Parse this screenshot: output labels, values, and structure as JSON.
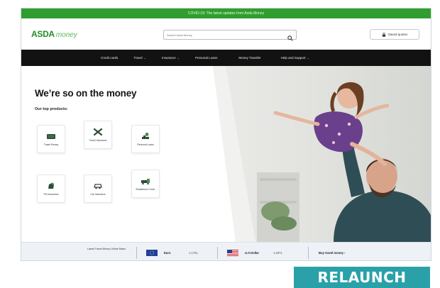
{
  "promo": {
    "text": "COVID-19: The latest updates from Asda Money"
  },
  "header": {
    "logo_brand": "ASDA",
    "logo_product": "money",
    "search_placeholder": "Search Asda Money",
    "save_button_label": "Saved quotes"
  },
  "nav": {
    "items": [
      {
        "label": "Credit cards",
        "has_chevron": false
      },
      {
        "label": "Travel",
        "has_chevron": true
      },
      {
        "label": "Insurance",
        "has_chevron": true
      },
      {
        "label": "Personal Loans",
        "has_chevron": false
      },
      {
        "label": "Money Transfer",
        "has_chevron": false
      },
      {
        "label": "Help and Support",
        "has_chevron": true
      }
    ]
  },
  "hero": {
    "title": "We’re so on the money",
    "subtitle": "Our top products:"
  },
  "products": [
    {
      "label": "Travel Money",
      "icon": "travel-money-icon"
    },
    {
      "label": "Travel Insurance",
      "icon": "plane-icon"
    },
    {
      "label": "Personal Loans",
      "icon": "personal-loans-icon"
    },
    {
      "label": "Pet Insurance",
      "icon": "pet-icon"
    },
    {
      "label": "Car Insurance",
      "icon": "car-icon"
    },
    {
      "label": "Breakdown Cover",
      "icon": "breakdown-icon"
    }
  ],
  "rates": {
    "title": "Latest Travel Money Online Rates",
    "currencies": [
      {
        "name": "Euro",
        "rate": "1.1761",
        "flag": "eu-flag-icon"
      },
      {
        "name": "U.S Dollar",
        "rate": "1.2871",
        "flag": "us-flag-icon"
      }
    ],
    "buy_link": "Buy travel money ›"
  },
  "badge": {
    "text": "RELAUNCH"
  },
  "colors": {
    "brand_green": "#2f9e2e",
    "nav_black": "#121212",
    "badge_teal": "#2aa1a8"
  }
}
